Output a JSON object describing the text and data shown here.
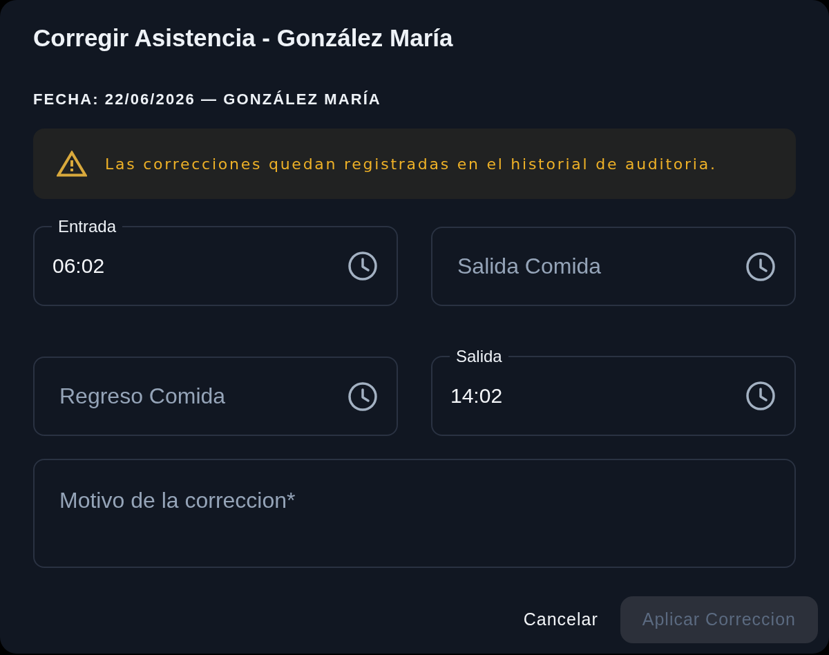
{
  "dialog": {
    "title": "Corregir Asistencia - González María",
    "subtitle": "FECHA: 22/06/2026 — GONZÁLEZ MARÍA",
    "alert": {
      "text": "Las correcciones quedan registradas en el historial de auditoria."
    },
    "time_fields": [
      {
        "label": "Entrada",
        "value": "06:02"
      },
      {
        "placeholder": "Salida Comida"
      },
      {
        "placeholder": "Regreso Comida"
      },
      {
        "label": "Salida",
        "value": "14:02"
      }
    ],
    "reason_field": {
      "placeholder": "Motivo de la correccion*"
    },
    "buttons": [
      {
        "label": "Cancelar",
        "kind": "text",
        "disabled": false
      },
      {
        "label": "Aplicar Correccion",
        "kind": "filled",
        "disabled": true
      }
    ]
  }
}
